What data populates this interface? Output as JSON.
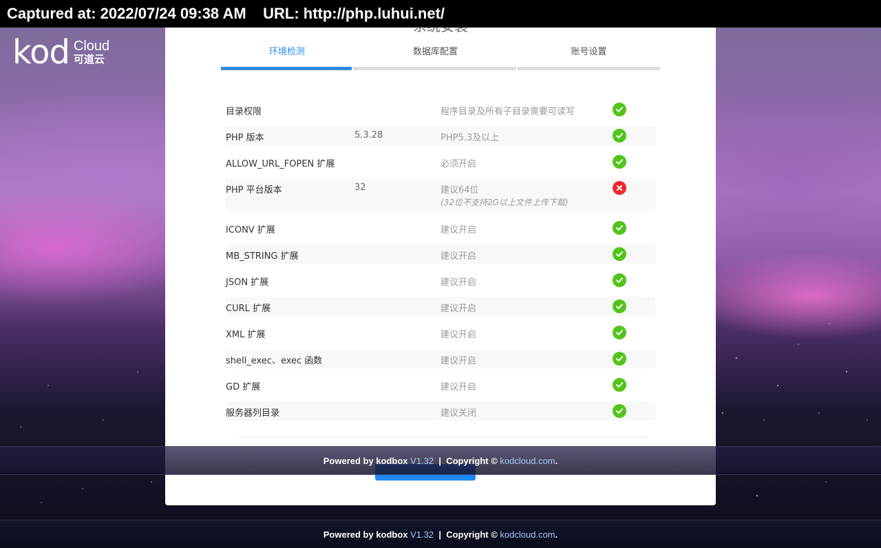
{
  "capture": {
    "text": "Captured at: 2022/07/24 09:38 AM    URL: http://php.luhui.net/"
  },
  "logo": {
    "brand": "kod",
    "cloud": "Cloud",
    "cn": "可道云"
  },
  "card": {
    "title": "系统安装"
  },
  "tabs": [
    {
      "label": "环境检测",
      "active": true
    },
    {
      "label": "数据库配置",
      "active": false
    },
    {
      "label": "账号设置",
      "active": false
    }
  ],
  "checks": [
    {
      "name": "目录权限",
      "value": "",
      "requirement": "程序目录及所有子目录需要可读写",
      "note": "",
      "status": "ok"
    },
    {
      "name": "PHP 版本",
      "value": "5.3.28",
      "requirement": "PHP5.3及以上",
      "note": "",
      "status": "ok"
    },
    {
      "name": "ALLOW_URL_FOPEN 扩展",
      "value": "",
      "requirement": "必须开启",
      "note": "",
      "status": "ok"
    },
    {
      "name": "PHP 平台版本",
      "value": "32",
      "requirement": "建议64位",
      "note": "(32位不支持2G以上文件上传下载)",
      "status": "fail"
    },
    {
      "name": "ICONV 扩展",
      "value": "",
      "requirement": "建议开启",
      "note": "",
      "status": "ok"
    },
    {
      "name": "MB_STRING 扩展",
      "value": "",
      "requirement": "建议开启",
      "note": "",
      "status": "ok"
    },
    {
      "name": "JSON 扩展",
      "value": "",
      "requirement": "建议开启",
      "note": "",
      "status": "ok"
    },
    {
      "name": "CURL 扩展",
      "value": "",
      "requirement": "建议开启",
      "note": "",
      "status": "ok"
    },
    {
      "name": "XML 扩展",
      "value": "",
      "requirement": "建议开启",
      "note": "",
      "status": "ok"
    },
    {
      "name": "shell_exec、exec 函数",
      "value": "",
      "requirement": "建议开启",
      "note": "",
      "status": "ok"
    },
    {
      "name": "GD 扩展",
      "value": "",
      "requirement": "建议开启",
      "note": "",
      "status": "ok"
    },
    {
      "name": "服务器列目录",
      "value": "",
      "requirement": "建议关闭",
      "note": "",
      "status": "ok"
    }
  ],
  "footer": {
    "powered": "Powered by kodbox ",
    "version": "V1.32",
    "sep": "  |  Copyright © ",
    "link": "kodcloud.com",
    "end": "."
  },
  "colors": {
    "accent": "#2d8ce4",
    "ok": "#52c41a",
    "fail": "#f0282d"
  }
}
